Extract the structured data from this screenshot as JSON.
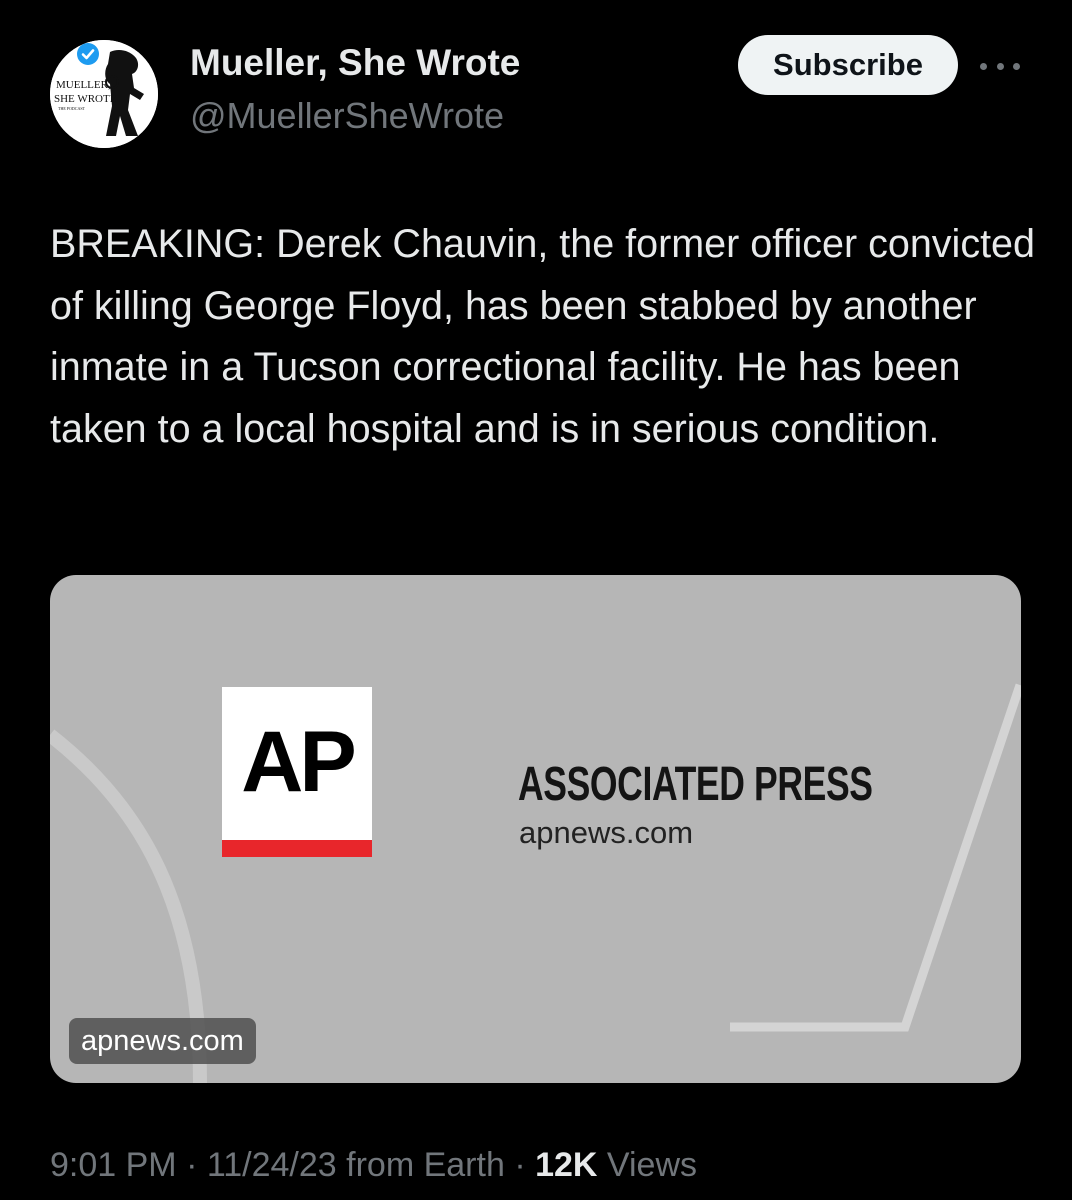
{
  "author": {
    "name": "Mueller, She Wrote",
    "handle": "@MuellerSheWrote",
    "avatar_text": [
      "MUELLER,",
      "SHE WROTE",
      "THE PODCAST"
    ],
    "verified_color": "#1d9bf0"
  },
  "header": {
    "subscribe_label": "Subscribe",
    "more_icon": "more-horizontal-icon"
  },
  "tweet": {
    "text": "BREAKING: Derek Chauvin, the former officer convicted of killing George Floyd, has been stabbed by another inmate in a Tucson correctional facility. He has been taken to a local hospital and is in serious condition."
  },
  "link_card": {
    "logo_text": "AP",
    "title": "ASSOCIATED PRESS",
    "domain": "apnews.com",
    "badge": "apnews.com",
    "colors": {
      "background": "#b6b6b6",
      "logo_accent": "#e8262b"
    }
  },
  "meta": {
    "time": "9:01 PM",
    "separator": "·",
    "date": "11/24/23",
    "source": "from Earth",
    "views_count": "12K",
    "views_label": "Views"
  }
}
